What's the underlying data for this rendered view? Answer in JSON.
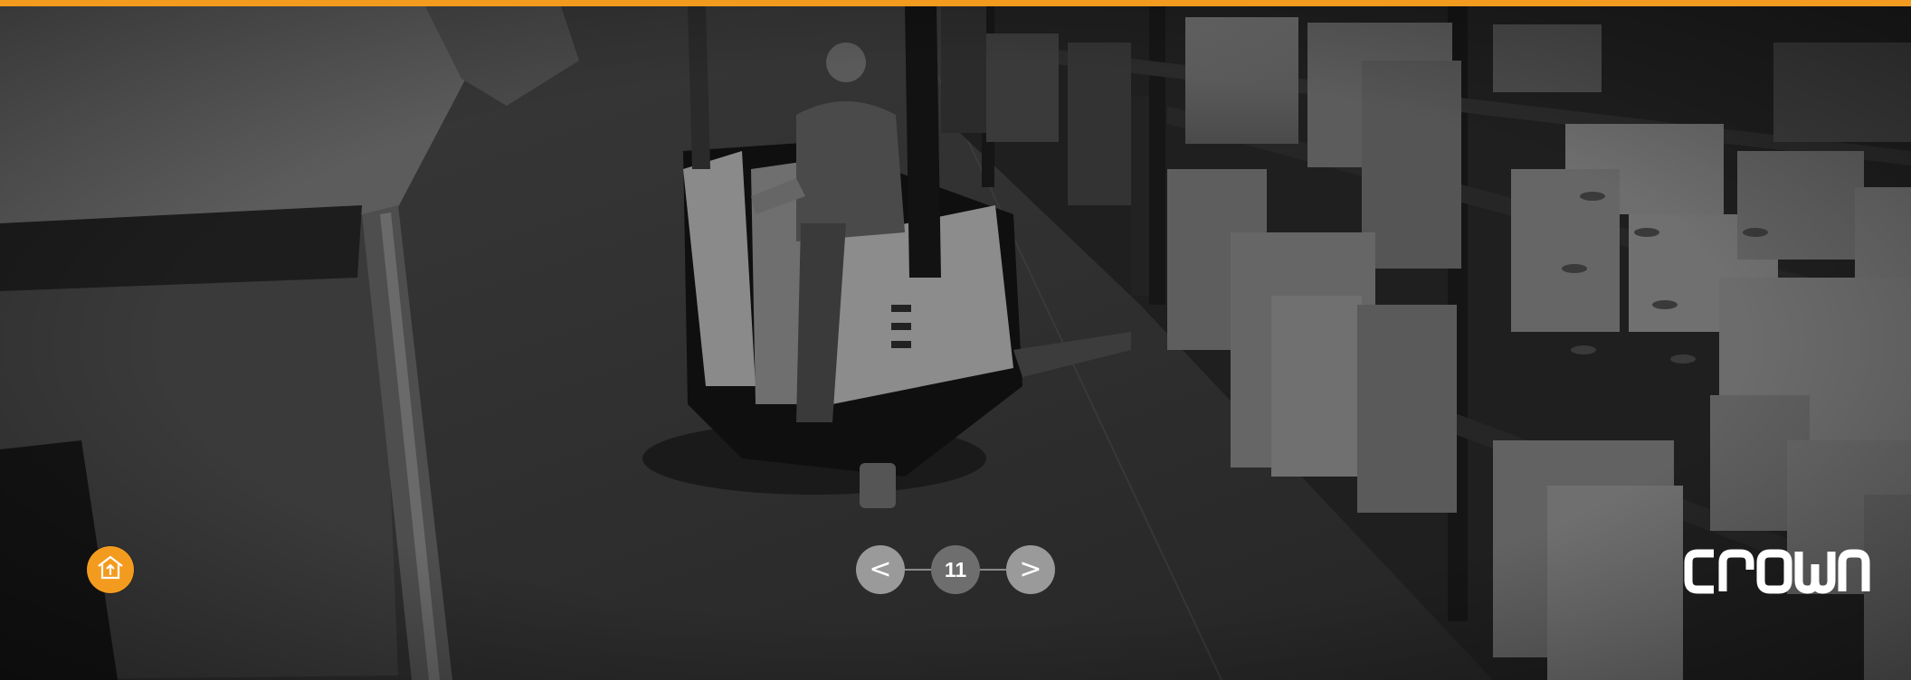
{
  "colors": {
    "accent": "#f39b1f",
    "nav_button": "#9a9a9a",
    "page_indicator": "#6e6e6e",
    "scene_tone": "#2b2b2b"
  },
  "background": {
    "description_icon": "warehouse-photo"
  },
  "home": {
    "icon": "home-up-icon"
  },
  "navigation": {
    "prev_label": "<",
    "next_label": ">",
    "page_number": "11"
  },
  "brand": {
    "logo_text": "CROWN"
  }
}
